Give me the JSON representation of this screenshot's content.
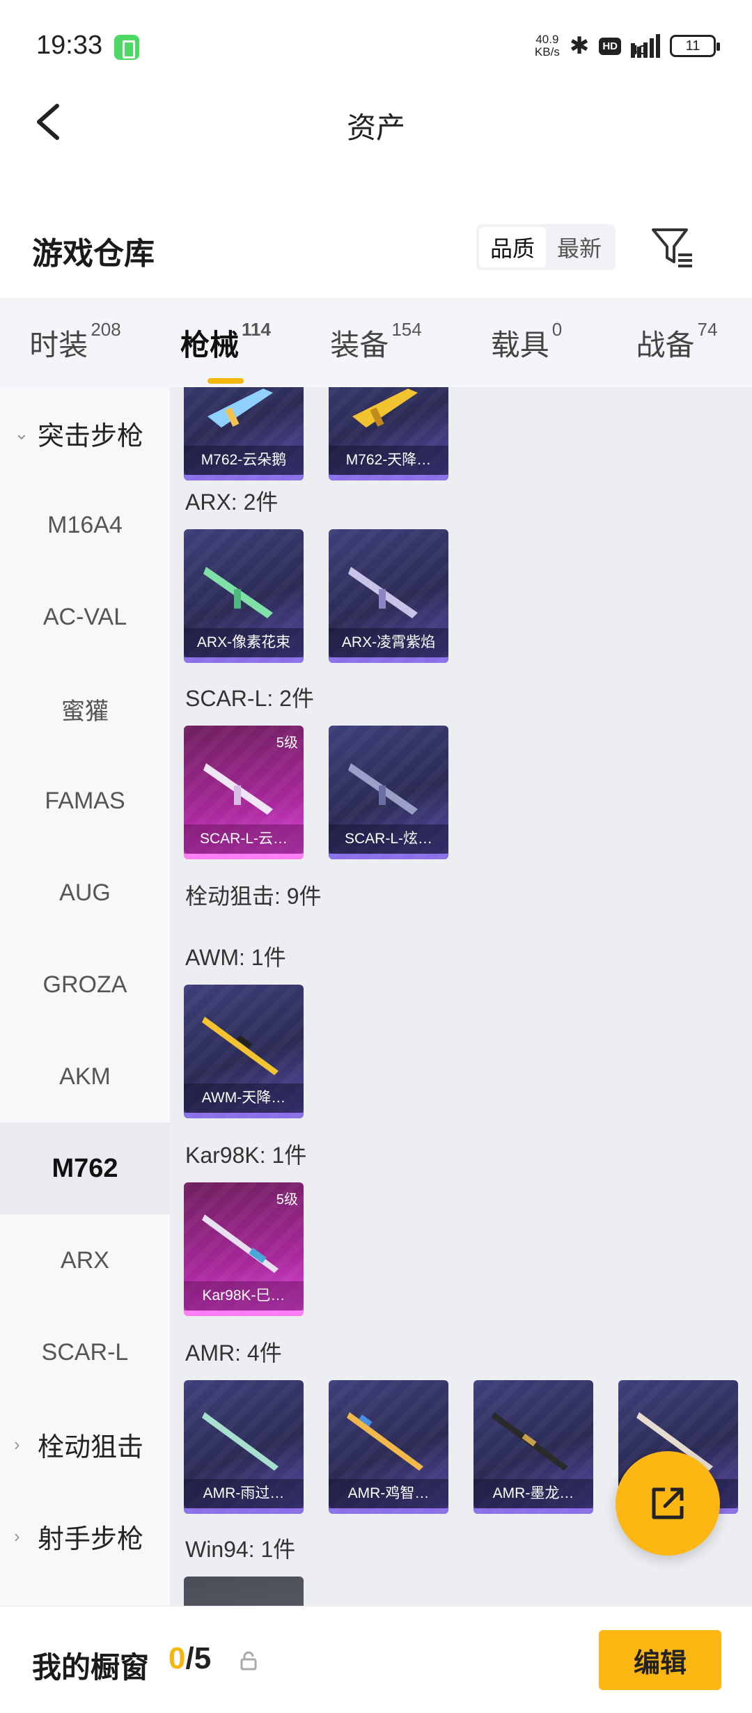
{
  "status_bar": {
    "time": "19:33",
    "net_speed_value": "40.9",
    "net_speed_unit": "KB/s",
    "network": "4G",
    "hd": "HD",
    "battery": "11"
  },
  "header": {
    "title": "资产",
    "back_icon": "chevron-left-icon"
  },
  "warehouse": {
    "title": "游戏仓库",
    "sort_options": [
      "品质",
      "最新"
    ],
    "sort_selected": "品质",
    "filter_icon": "filter-icon"
  },
  "category_tabs": [
    {
      "label": "时装",
      "count": "208"
    },
    {
      "label": "枪械",
      "count": "114",
      "active": true
    },
    {
      "label": "装备",
      "count": "154"
    },
    {
      "label": "载具",
      "count": "0"
    },
    {
      "label": "战备",
      "count": "74"
    }
  ],
  "side_nav": [
    {
      "label": "突击步枪",
      "group": true,
      "expanded": true
    },
    {
      "label": "M16A4"
    },
    {
      "label": "AC-VAL"
    },
    {
      "label": "蜜獾"
    },
    {
      "label": "FAMAS"
    },
    {
      "label": "AUG"
    },
    {
      "label": "GROZA"
    },
    {
      "label": "AKM"
    },
    {
      "label": "M762",
      "active": true
    },
    {
      "label": "ARX"
    },
    {
      "label": "SCAR-L"
    },
    {
      "label": "栓动狙击",
      "group": true
    },
    {
      "label": "射手步枪",
      "group": true
    }
  ],
  "sections": [
    {
      "label": "",
      "items": [
        {
          "name": "M762-云朵鹅"
        },
        {
          "name": "M762-天降…"
        }
      ]
    },
    {
      "label": "ARX: 2件",
      "items": [
        {
          "name": "ARX-像素花束"
        },
        {
          "name": "ARX-凌霄紫焰"
        }
      ]
    },
    {
      "label": "SCAR-L: 2件",
      "items": [
        {
          "name": "SCAR-L-云…",
          "level": "5级",
          "rarity": "pink"
        },
        {
          "name": "SCAR-L-炫…"
        }
      ]
    },
    {
      "label": "栓动狙击: 9件",
      "items": []
    },
    {
      "label": "AWM: 1件",
      "items": [
        {
          "name": "AWM-天降…"
        }
      ]
    },
    {
      "label": "Kar98K: 1件",
      "items": [
        {
          "name": "Kar98K-巳…",
          "level": "5级",
          "rarity": "pink"
        }
      ]
    },
    {
      "label": "AMR: 4件",
      "items": [
        {
          "name": "AMR-雨过…"
        },
        {
          "name": "AMR-鸡智…"
        },
        {
          "name": "AMR-墨龙…"
        },
        {
          "name": ""
        }
      ]
    },
    {
      "label": "Win94: 1件",
      "items": [
        {
          "name": ""
        }
      ]
    }
  ],
  "showcase": {
    "label": "我的橱窗",
    "current": "0",
    "total": "/5"
  },
  "edit_label": "编辑",
  "colors": {
    "accent": "#fdb713",
    "card_purple": "#3e3f7a",
    "card_pink": "#a8289b"
  }
}
